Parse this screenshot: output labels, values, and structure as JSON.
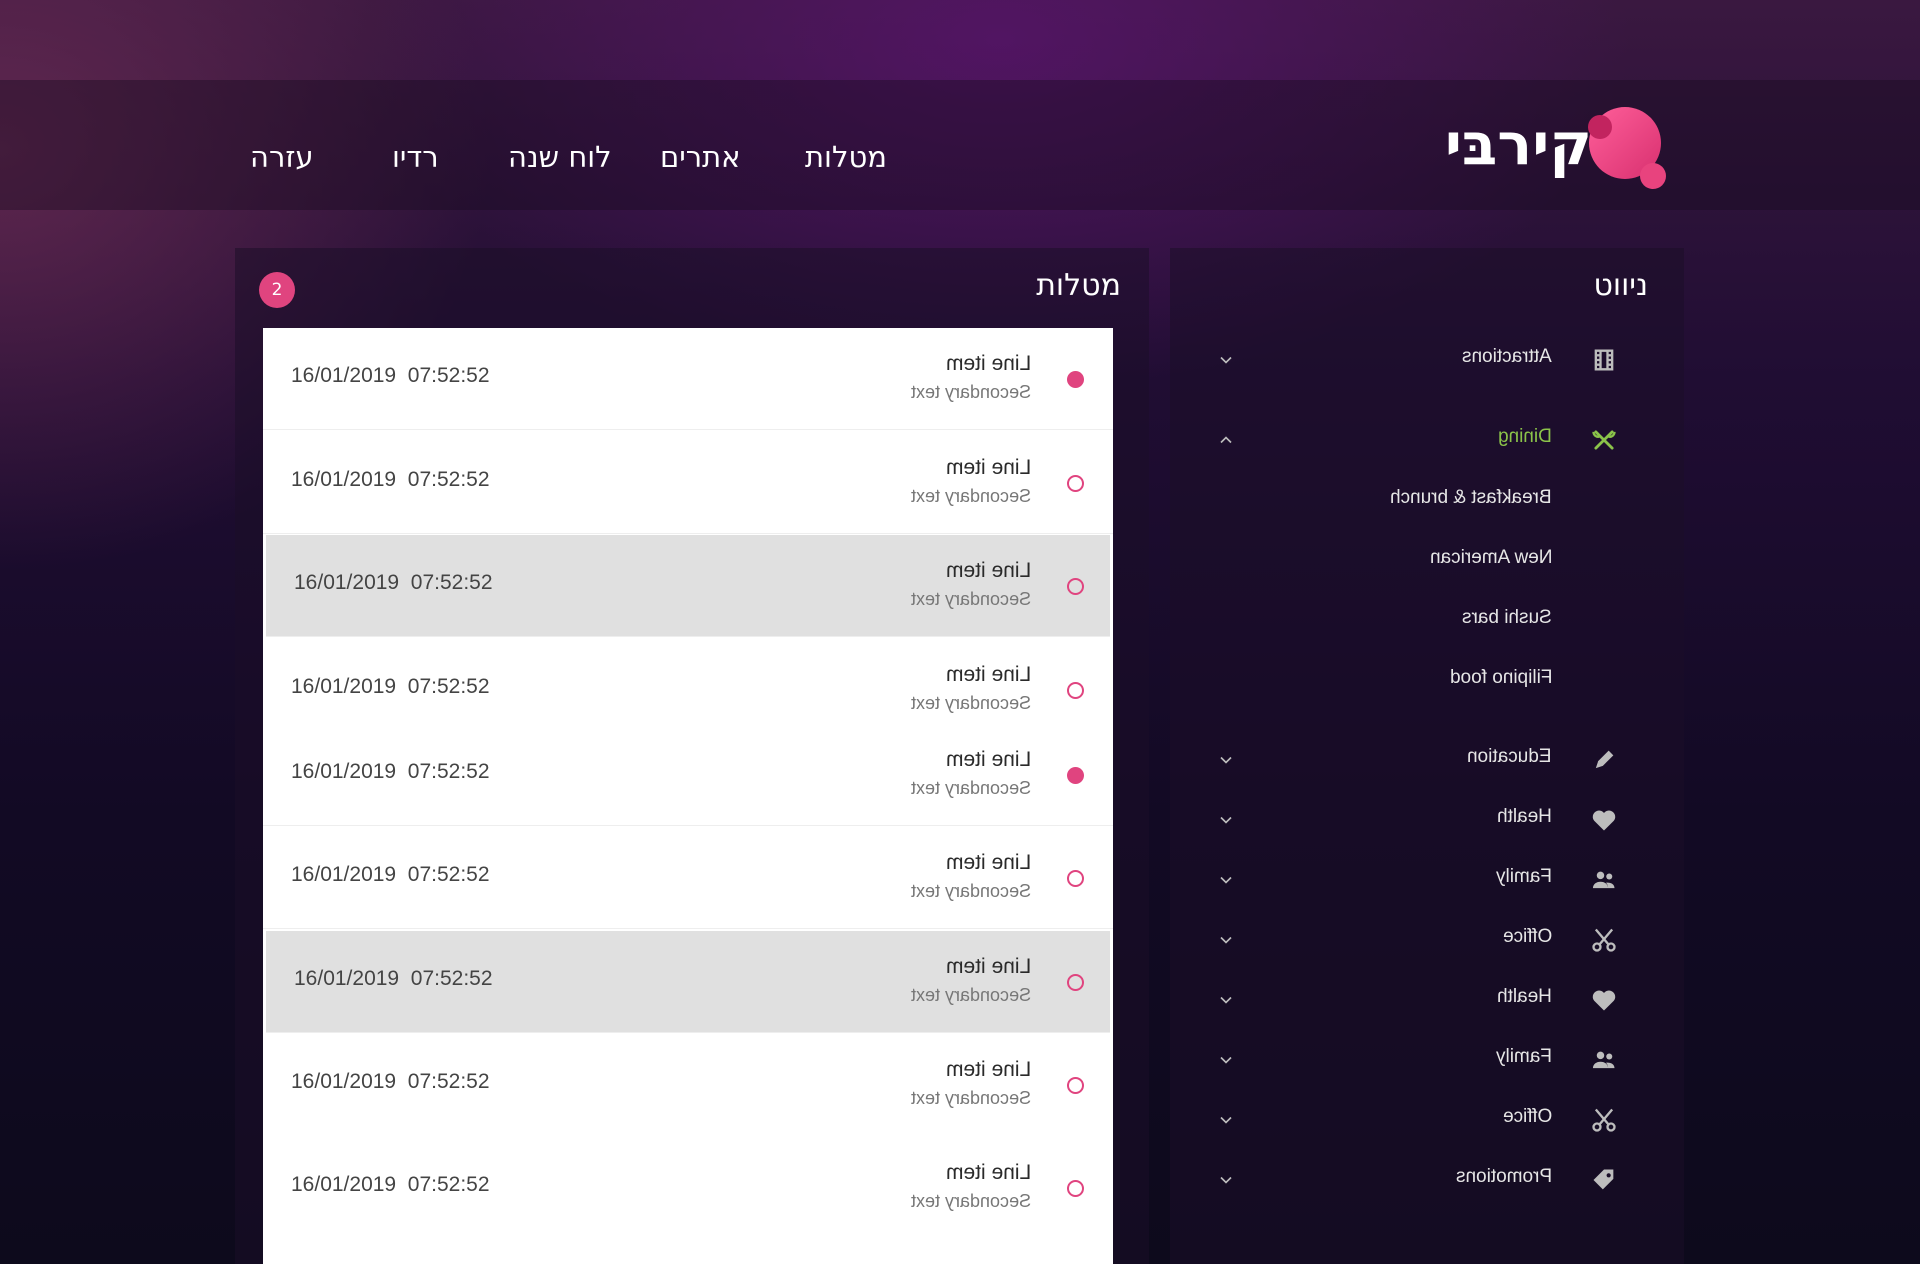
{
  "header": {
    "logo_text": "קירבּי",
    "nav": [
      {
        "label": "עזרה"
      },
      {
        "label": "רדיו"
      },
      {
        "label": "לוח שנה"
      },
      {
        "label": "אתרים"
      },
      {
        "label": "מטלות"
      }
    ]
  },
  "tasks": {
    "title": "מטלות",
    "badge_count": "2",
    "items": [
      {
        "title": "Line item",
        "secondary": "Secondary text",
        "date": "16/01/2019",
        "time": "07:52:52",
        "status": "filled"
      },
      {
        "title": "Line item",
        "secondary": "Secondary text",
        "date": "16/01/2019",
        "time": "07:52:52",
        "status": "outline"
      },
      {
        "title": "Line item",
        "secondary": "Secondary text",
        "date": "16/01/2019",
        "time": "07:52:52",
        "status": "outline",
        "selected": true
      },
      {
        "title": "Line item",
        "secondary": "Secondary text",
        "date": "16/01/2019",
        "time": "07:52:52",
        "status": "outline"
      },
      {
        "title": "Line item",
        "secondary": "Secondary text",
        "date": "16/01/2019",
        "time": "07:52:52",
        "status": "filled"
      },
      {
        "title": "Line item",
        "secondary": "Secondary text",
        "date": "16/01/2019",
        "time": "07:52:52",
        "status": "outline"
      },
      {
        "title": "Line item",
        "secondary": "Secondary text",
        "date": "16/01/2019",
        "time": "07:52:52",
        "status": "outline",
        "selected": true
      },
      {
        "title": "Line item",
        "secondary": "Secondary text",
        "date": "16/01/2019",
        "time": "07:52:52",
        "status": "outline"
      },
      {
        "title": "Line item",
        "secondary": "Secondary text",
        "date": "16/01/2019",
        "time": "07:52:52",
        "status": "outline"
      }
    ]
  },
  "navigation": {
    "title": "ניווט",
    "items": [
      {
        "label": "Attractions",
        "icon": "film-icon",
        "expanded": false
      },
      {
        "label": "Dining",
        "icon": "fork-knife-icon",
        "expanded": true,
        "active": true,
        "children": [
          {
            "label": "Breakfast & brunch"
          },
          {
            "label": "New American"
          },
          {
            "label": "Sushi bars"
          },
          {
            "label": "Filipino food"
          }
        ]
      },
      {
        "label": "Education",
        "icon": "pencil-icon",
        "expanded": false
      },
      {
        "label": "Health",
        "icon": "heart-icon",
        "expanded": false
      },
      {
        "label": "Family",
        "icon": "people-icon",
        "expanded": false
      },
      {
        "label": "Office",
        "icon": "scissors-icon",
        "expanded": false
      },
      {
        "label": "Health",
        "icon": "heart-icon",
        "expanded": false
      },
      {
        "label": "Family",
        "icon": "people-icon",
        "expanded": false
      },
      {
        "label": "Office",
        "icon": "scissors-icon",
        "expanded": false
      },
      {
        "label": "Promotions",
        "icon": "tag-icon",
        "expanded": false
      }
    ]
  },
  "colors": {
    "accent": "#e0447f",
    "active_nav": "#8bc34a",
    "selected_row": "#e0e0e0",
    "icon_gray": "#bdbdbd"
  }
}
